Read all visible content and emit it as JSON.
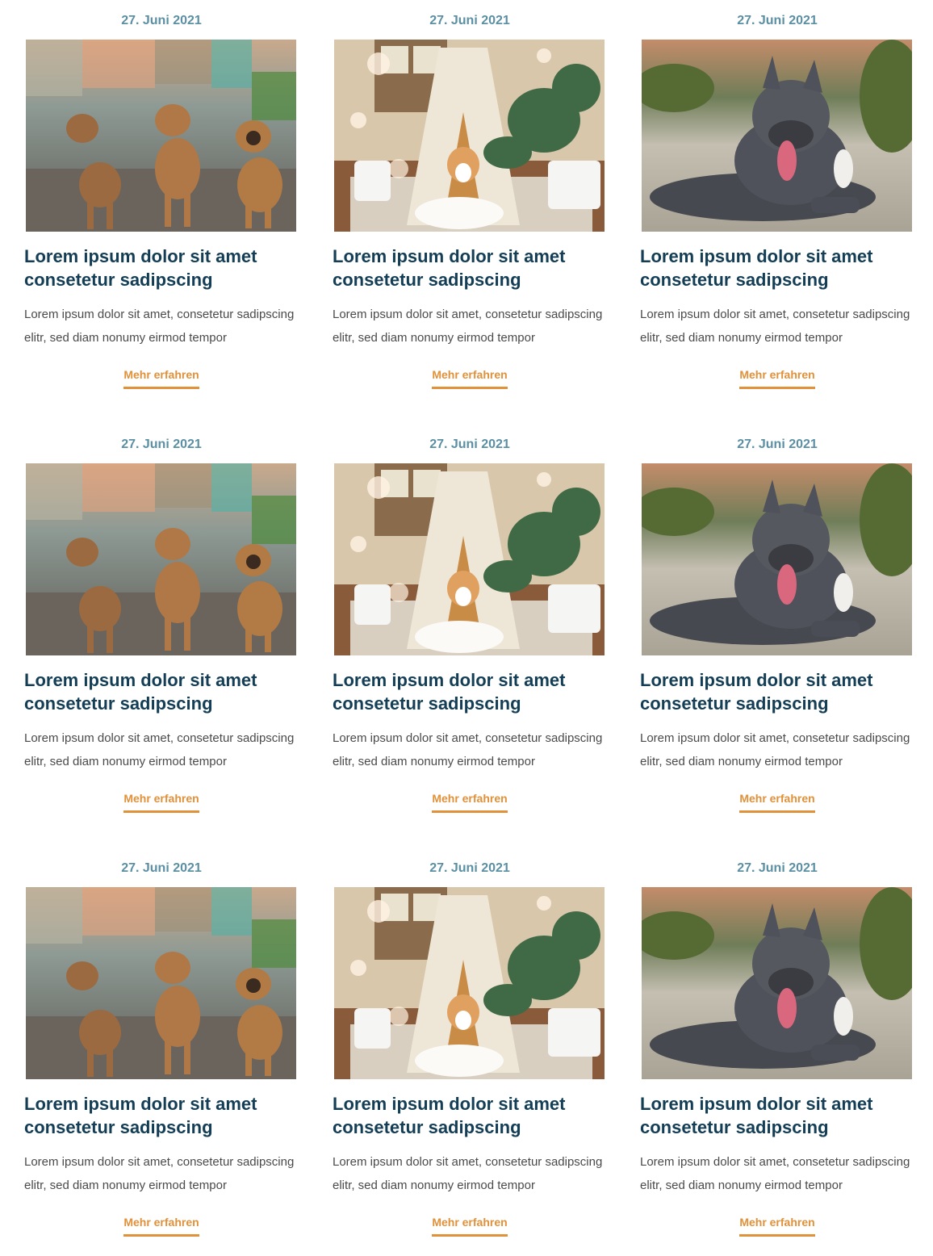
{
  "colors": {
    "date": "#5b8fa3",
    "title": "#143e55",
    "excerpt": "#4a4a4a",
    "link": "#e0913a"
  },
  "posts": [
    {
      "date": "27. Juni 2021",
      "image": "three-puppies-photo",
      "title": "Lorem ipsum dolor sit amet cons­etetur sadipscing",
      "excerpt": "Lorem ipsum dolor sit amet, consetetur sadipsc­ing elitr, sed diam nonumy eirmod tempor",
      "link": "Mehr erfahren"
    },
    {
      "date": "27. Juni 2021",
      "image": "corgi-teepee-photo",
      "title": "Lorem ipsum dolor sit amet cons­etetur sadipscing",
      "excerpt": "Lorem ipsum dolor sit amet, consetetur sadipsc­ing elitr, sed diam nonumy eirmod tempor",
      "link": "Mehr erfahren"
    },
    {
      "date": "27. Juni 2021",
      "image": "grey-pitbull-photo",
      "title": "Lorem ipsum dolor sit amet cons­etetur sadipscing",
      "excerpt": "Lorem ipsum dolor sit amet, consetetur sadipsc­ing elitr, sed diam nonumy eirmod tempor",
      "link": "Mehr erfahren"
    },
    {
      "date": "27. Juni 2021",
      "image": "three-puppies-photo",
      "title": "Lorem ipsum dolor sit amet cons­etetur sadipscing",
      "excerpt": "Lorem ipsum dolor sit amet, consetetur sadipsc­ing elitr, sed diam nonumy eirmod tempor",
      "link": "Mehr erfahren"
    },
    {
      "date": "27. Juni 2021",
      "image": "corgi-teepee-photo",
      "title": "Lorem ipsum dolor sit amet cons­etetur sadipscing",
      "excerpt": "Lorem ipsum dolor sit amet, consetetur sadipsc­ing elitr, sed diam nonumy eirmod tempor",
      "link": "Mehr erfahren"
    },
    {
      "date": "27. Juni 2021",
      "image": "grey-pitbull-photo",
      "title": "Lorem ipsum dolor sit amet cons­etetur sadipscing",
      "excerpt": "Lorem ipsum dolor sit amet, consetetur sadipsc­ing elitr, sed diam nonumy eirmod tempor",
      "link": "Mehr erfahren"
    },
    {
      "date": "27. Juni 2021",
      "image": "three-puppies-photo",
      "title": "Lorem ipsum dolor sit amet cons­etetur sadipscing",
      "excerpt": "Lorem ipsum dolor sit amet, consetetur sadipsc­ing elitr, sed diam nonumy eirmod tempor",
      "link": "Mehr erfahren"
    },
    {
      "date": "27. Juni 2021",
      "image": "corgi-teepee-photo",
      "title": "Lorem ipsum dolor sit amet cons­etetur sadipscing",
      "excerpt": "Lorem ipsum dolor sit amet, consetetur sadipsc­ing elitr, sed diam nonumy eirmod tempor",
      "link": "Mehr erfahren"
    },
    {
      "date": "27. Juni 2021",
      "image": "grey-pitbull-photo",
      "title": "Lorem ipsum dolor sit amet cons­etetur sadipscing",
      "excerpt": "Lorem ipsum dolor sit amet, consetetur sadipsc­ing elitr, sed diam nonumy eirmod tempor",
      "link": "Mehr erfahren"
    }
  ]
}
